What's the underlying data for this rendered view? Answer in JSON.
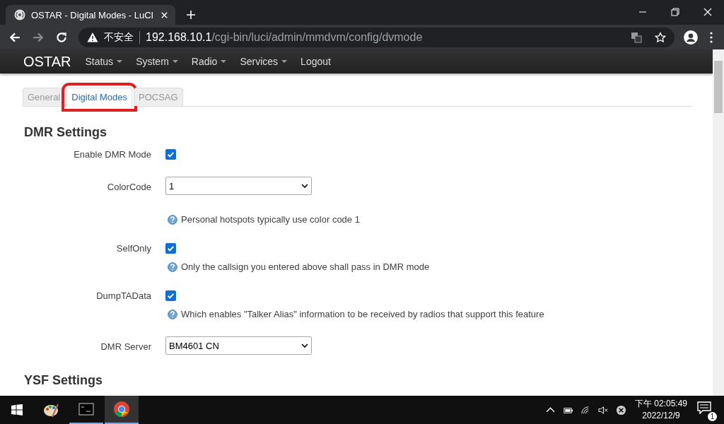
{
  "browser": {
    "tab_title": "OSTAR - Digital Modes - LuCI",
    "security_label": "不安全",
    "url_host": "192.168.10.1",
    "url_path": "/cgi-bin/luci/admin/mmdvm/config/dvmode"
  },
  "nav": {
    "brand": "OSTAR",
    "items": [
      {
        "label": "Status",
        "dropdown": true
      },
      {
        "label": "System",
        "dropdown": true
      },
      {
        "label": "Radio",
        "dropdown": true
      },
      {
        "label": "Services",
        "dropdown": true
      },
      {
        "label": "Logout",
        "dropdown": false
      }
    ]
  },
  "tabs": [
    {
      "label": "General",
      "selected": false,
      "highlighted": false
    },
    {
      "label": "Digital Modes",
      "selected": true,
      "highlighted": true
    },
    {
      "label": "POCSAG",
      "selected": false,
      "highlighted": false
    }
  ],
  "sections": [
    {
      "title": "DMR Settings",
      "fields": [
        {
          "kind": "checkbox",
          "label": "Enable DMR Mode",
          "checked": true
        },
        {
          "kind": "select",
          "label": "ColorCode",
          "value": "1",
          "hint": "Personal hotspots typically use color code 1"
        },
        {
          "kind": "checkbox",
          "label": "SelfOnly",
          "checked": true,
          "hint": "Only the callsign you entered above shall pass in DMR mode"
        },
        {
          "kind": "checkbox",
          "label": "DumpTAData",
          "checked": true,
          "hint": "Which enables \"Talker Alias\" information to be received by radios that support this feature"
        },
        {
          "kind": "select",
          "label": "DMR Server",
          "value": "BM4601 CN"
        }
      ]
    },
    {
      "title": "YSF Settings"
    }
  ],
  "taskbar": {
    "time": "下午 02:05:49",
    "date": "2022/12/9",
    "notifications": "1"
  }
}
